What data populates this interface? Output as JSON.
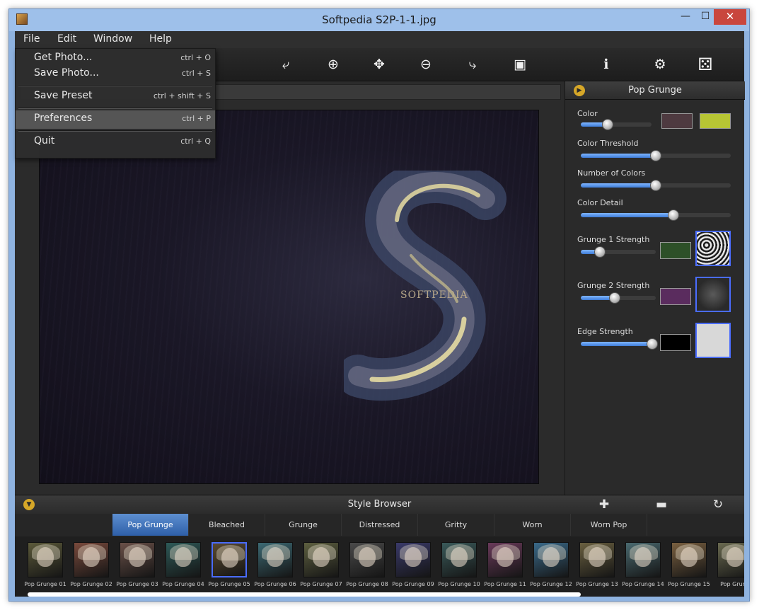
{
  "window": {
    "title": "Softpedia S2P-1-1.jpg",
    "minimize": "—",
    "maximize": "☐",
    "close": "✕"
  },
  "menubar": [
    "File",
    "Edit",
    "Window",
    "Help"
  ],
  "file_menu": [
    {
      "label": "Get Photo...",
      "shortcut": "ctrl + O"
    },
    {
      "label": "Save Photo...",
      "shortcut": "ctrl + S"
    },
    {
      "label": "Save Preset",
      "shortcut": "ctrl + shift + S"
    },
    {
      "label": "Preferences",
      "shortcut": "ctrl + P"
    },
    {
      "label": "Quit",
      "shortcut": "ctrl + Q"
    }
  ],
  "toolbar": {
    "icons": [
      "rotate-left-icon",
      "zoom-in-icon",
      "move-icon",
      "zoom-out-icon",
      "rotate-right-icon",
      "fit-image-icon",
      "info-icon",
      "settings-icon",
      "randomize-dice-icon"
    ],
    "glyphs": [
      "⤶",
      "⊕",
      "✥",
      "⊖",
      "⤷",
      "▣",
      "ℹ",
      "⚙",
      "⚄"
    ]
  },
  "photo": {
    "watermark": "SOFTPEDIA"
  },
  "properties": {
    "title": "Pop Grunge",
    "controls": [
      {
        "label": "Color",
        "value": 0.38,
        "swatches": [
          "#4e3a40",
          "#b7c534"
        ]
      },
      {
        "label": "Color Threshold",
        "value": 0.5
      },
      {
        "label": "Number of Colors",
        "value": 0.5
      },
      {
        "label": "Color Detail",
        "value": 0.62
      },
      {
        "label": "Grunge 1 Strength",
        "value": 0.25,
        "swatches": [
          "#2d5028"
        ]
      },
      {
        "label": "Grunge 2 Strength",
        "value": 0.45,
        "swatches": [
          "#5a2c5e"
        ]
      },
      {
        "label": "Edge Strength",
        "value": 0.95,
        "swatches": [
          "#000000",
          "#d8d8d8"
        ]
      }
    ]
  },
  "style_browser": {
    "title": "Style Browser",
    "icons": {
      "add": "✚",
      "remove": "▬",
      "reset": "↻"
    },
    "tabs": [
      "Pop Grunge",
      "Bleached",
      "Grunge",
      "Distressed",
      "Gritty",
      "Worn",
      "Worn Pop"
    ],
    "active_tab": "Pop Grunge",
    "thumbnails": [
      "Pop Grunge 01",
      "Pop Grunge 02",
      "Pop Grunge 03",
      "Pop Grunge 04",
      "Pop Grunge 05",
      "Pop Grunge 06",
      "Pop Grunge 07",
      "Pop Grunge 08",
      "Pop Grunge 09",
      "Pop Grunge 10",
      "Pop Grunge 11",
      "Pop Grunge 12",
      "Pop Grunge 13",
      "Pop Grunge 14",
      "Pop Grunge 15",
      "Pop Grung"
    ],
    "selected_thumbnail": "Pop Grunge 05",
    "thumbnail_tints": [
      "#5c5a3a",
      "#7a4a3c",
      "#6a5048",
      "#2e5a58",
      "#5a4a30",
      "#3c6a74",
      "#5e6040",
      "#4a4a4a",
      "#3a3a6a",
      "#3a5a5a",
      "#6a3a5a",
      "#3a6a8a",
      "#6a6040",
      "#4a6a70",
      "#7a6040",
      "#6a6a50"
    ]
  }
}
